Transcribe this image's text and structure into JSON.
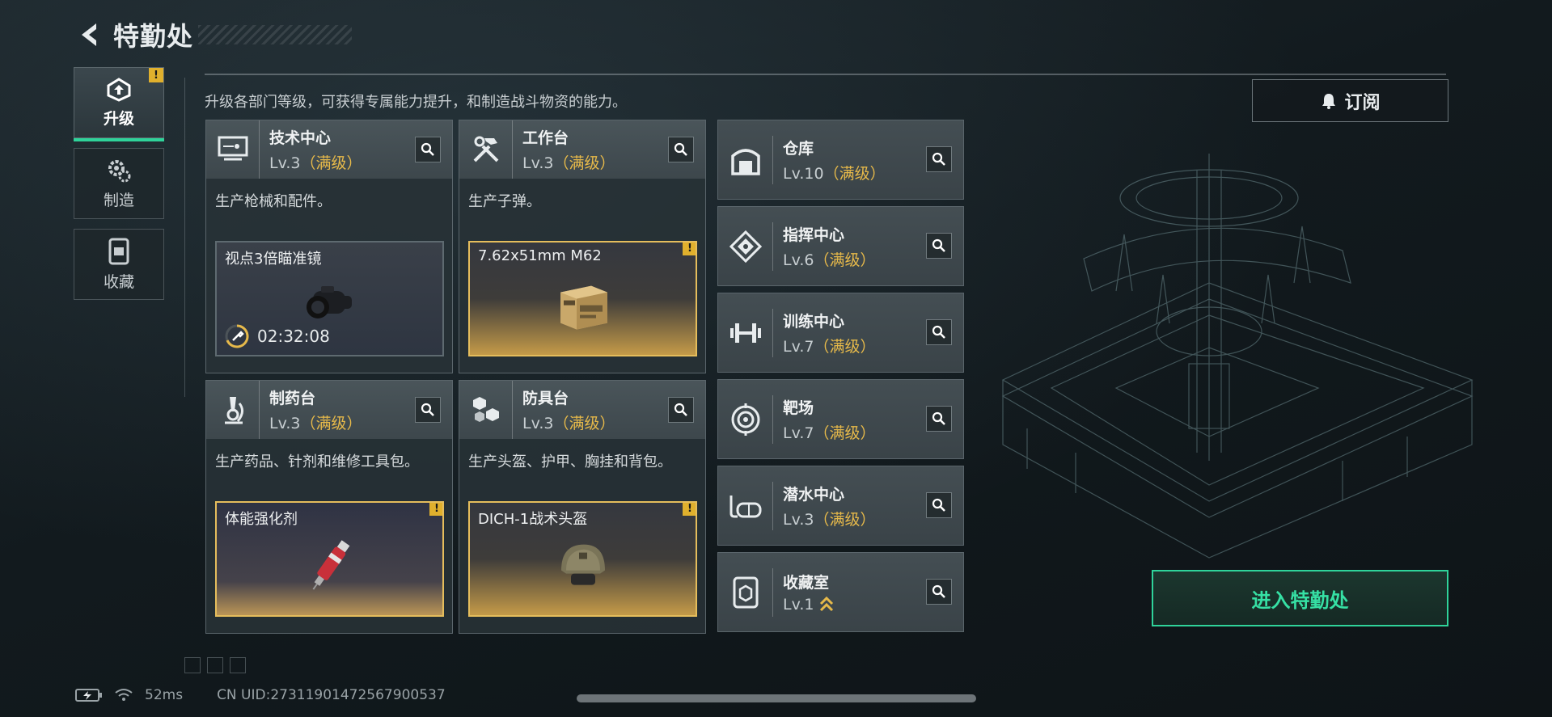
{
  "header": {
    "title": "特勤处"
  },
  "nav": [
    {
      "label": "升级",
      "icon": "upgrade-icon",
      "active": true,
      "alert": "!"
    },
    {
      "label": "制造",
      "icon": "gear-icon",
      "active": false
    },
    {
      "label": "收藏",
      "icon": "collection-icon",
      "active": false
    }
  ],
  "description": "升级各部门等级，可获得专属能力提升，和制造战斗物资的能力。",
  "subscribe_label": "订阅",
  "big_cards": [
    {
      "name": "技术中心",
      "lv": "Lv.3",
      "maxed": "（满级）",
      "desc": "生产枪械和配件。",
      "product": "视点3倍瞄准镜",
      "timer": "02:32:08"
    },
    {
      "name": "工作台",
      "lv": "Lv.3",
      "maxed": "（满级）",
      "desc": "生产子弹。",
      "product": "7.62x51mm M62",
      "alert": "!"
    },
    {
      "name": "制药台",
      "lv": "Lv.3",
      "maxed": "（满级）",
      "desc": "生产药品、针剂和维修工具包。",
      "product": "体能强化剂",
      "alert": "!"
    },
    {
      "name": "防具台",
      "lv": "Lv.3",
      "maxed": "（满级）",
      "desc": "生产头盔、护甲、胸挂和背包。",
      "product": "DICH-1战术头盔",
      "alert": "!"
    }
  ],
  "small_cards": [
    {
      "name": "仓库",
      "lv": "Lv.10",
      "maxed": "（满级）",
      "icon": "warehouse-icon"
    },
    {
      "name": "指挥中心",
      "lv": "Lv.6",
      "maxed": "（满级）",
      "icon": "command-icon"
    },
    {
      "name": "训练中心",
      "lv": "Lv.7",
      "maxed": "（满级）",
      "icon": "dumbbell-icon"
    },
    {
      "name": "靶场",
      "lv": "Lv.7",
      "maxed": "（满级）",
      "icon": "target-icon"
    },
    {
      "name": "潜水中心",
      "lv": "Lv.3",
      "maxed": "（满级）",
      "icon": "diving-mask-icon"
    },
    {
      "name": "收藏室",
      "lv": "Lv.1",
      "maxed": "",
      "icon": "collection-room-icon"
    }
  ],
  "enter_label": "进入特勤处",
  "status": {
    "ping": "52ms",
    "uid": "CN UID:27311901472567900537"
  },
  "colors": {
    "accent": "#2fd39a",
    "gold": "#e6b94a",
    "alert": "#e0b02d"
  }
}
